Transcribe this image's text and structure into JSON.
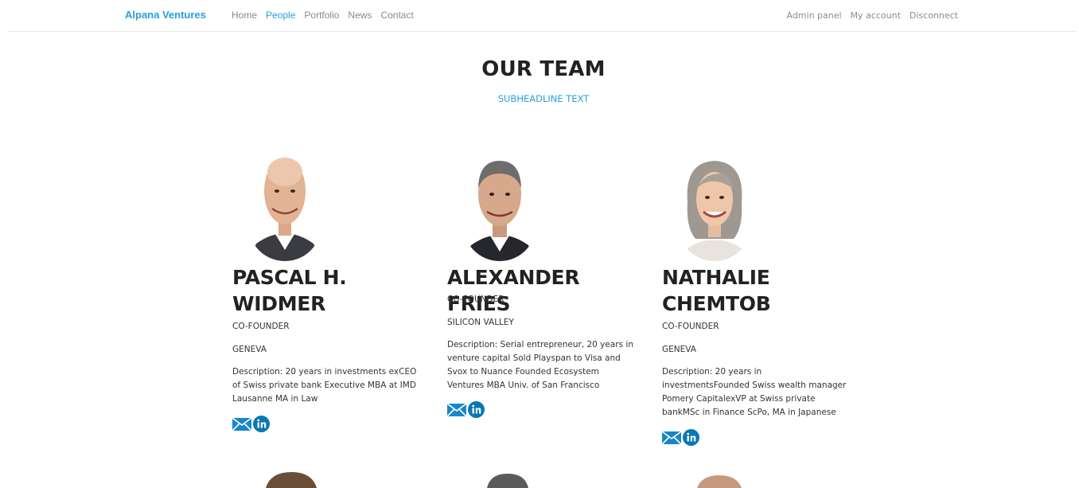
{
  "nav": {
    "brand": "Alpana Ventures",
    "links": [
      "Home",
      "People",
      "Portfolio",
      "News",
      "Contact"
    ],
    "active": "People",
    "right_links": [
      "Admin panel",
      "My account",
      "Disconnect"
    ]
  },
  "page": {
    "headline": "OUR TEAM",
    "subheadline": "SUBHEADLINE TEXT"
  },
  "team": [
    {
      "name": "PASCAL H. WIDMER",
      "role": "CO-FOUNDER",
      "city": "GENEVA",
      "description": "Description: 20 years in investments exCEO of Swiss private bank Executive MBA at IMD Lausanne MA in Law"
    },
    {
      "name": "ALEXANDER FRIES",
      "role": "CO-FOUNDER",
      "city": "SILICON VALLEY",
      "description": "Description: Serial entrepreneur, 20 years in venture capital Sold Playspan to Visa and Svox to Nuance Founded Ecosystem Ventures MBA Univ. of San Francisco"
    },
    {
      "name": "NATHALIE CHEMTOB",
      "role": "CO-FOUNDER",
      "city": "GENEVA",
      "description": "Description: 20 years in investmentsFounded Swiss wealth manager Pomery CapitalexVP at Swiss private bankMSc in Finance ScPo, MA in Japanese"
    }
  ],
  "colors": {
    "accent": "#2a9fd8",
    "linkedin": "#0a77b5",
    "mail": "#1a86c8"
  },
  "icons": [
    "mail-icon",
    "linkedin-icon"
  ]
}
